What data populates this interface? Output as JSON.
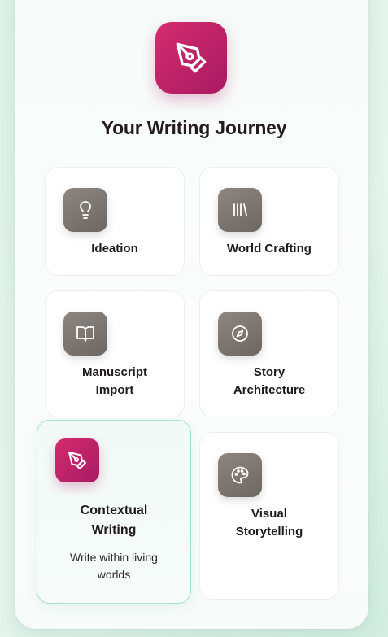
{
  "header": {
    "title": "Your Writing Journey",
    "icon": "pen-tool-icon",
    "accent_color": "#c4246a"
  },
  "steps": [
    {
      "label": "Ideation",
      "icon": "lightbulb-icon"
    },
    {
      "label": "World Crafting",
      "icon": "library-icon"
    },
    {
      "label": "Manuscript Import",
      "icon": "book-open-icon"
    },
    {
      "label": "Story Architecture",
      "icon": "compass-icon"
    },
    {
      "label": "Contextual Writing",
      "icon": "pen-tool-icon",
      "description": "Write within living worlds",
      "active": true
    },
    {
      "label": "Visual Storytelling",
      "icon": "palette-icon"
    }
  ],
  "colors": {
    "active_border": "#a9e2c8",
    "icon_gray": "#7d7670",
    "background": "#e2f4ec"
  }
}
